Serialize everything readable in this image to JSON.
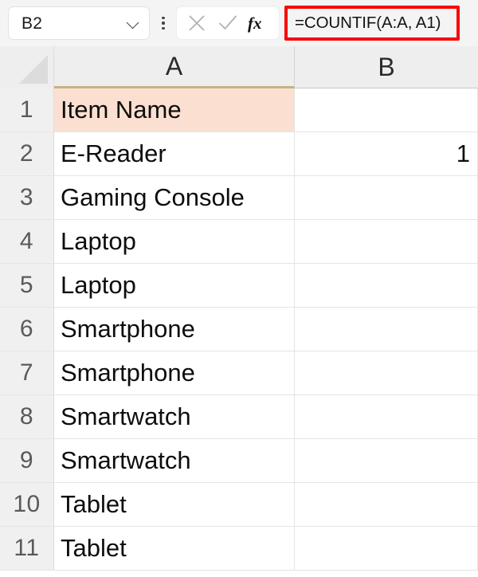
{
  "formula_bar": {
    "name_box_value": "B2",
    "name_box_dropdown_icon": "chevron-down-icon",
    "overflow_menu_icon": "kebab-menu-icon",
    "cancel_icon": "cancel-x-icon",
    "confirm_icon": "confirm-check-icon",
    "function_icon": "insert-function-fx-icon",
    "formula_value": "=COUNTIF(A:A, A1)",
    "formula_placeholder": "",
    "highlight_color": "#fb0606"
  },
  "grid": {
    "corner_name": "select-all-corner",
    "columns": [
      {
        "label": "A"
      },
      {
        "label": "B"
      }
    ],
    "header_fill_color": "#fbe0d1",
    "selected_cell": "B2",
    "rows": [
      {
        "num": "1",
        "a": "Item Name",
        "b": "",
        "highlight": true
      },
      {
        "num": "2",
        "a": "E-Reader",
        "b": "1",
        "highlight": false
      },
      {
        "num": "3",
        "a": "Gaming Console",
        "b": "",
        "highlight": false
      },
      {
        "num": "4",
        "a": "Laptop",
        "b": "",
        "highlight": false
      },
      {
        "num": "5",
        "a": "Laptop",
        "b": "",
        "highlight": false
      },
      {
        "num": "6",
        "a": "Smartphone",
        "b": "",
        "highlight": false
      },
      {
        "num": "7",
        "a": "Smartphone",
        "b": "",
        "highlight": false
      },
      {
        "num": "8",
        "a": "Smartwatch",
        "b": "",
        "highlight": false
      },
      {
        "num": "9",
        "a": "Smartwatch",
        "b": "",
        "highlight": false
      },
      {
        "num": "10",
        "a": "Tablet",
        "b": "",
        "highlight": false
      },
      {
        "num": "11",
        "a": "Tablet",
        "b": "",
        "highlight": false
      }
    ]
  }
}
